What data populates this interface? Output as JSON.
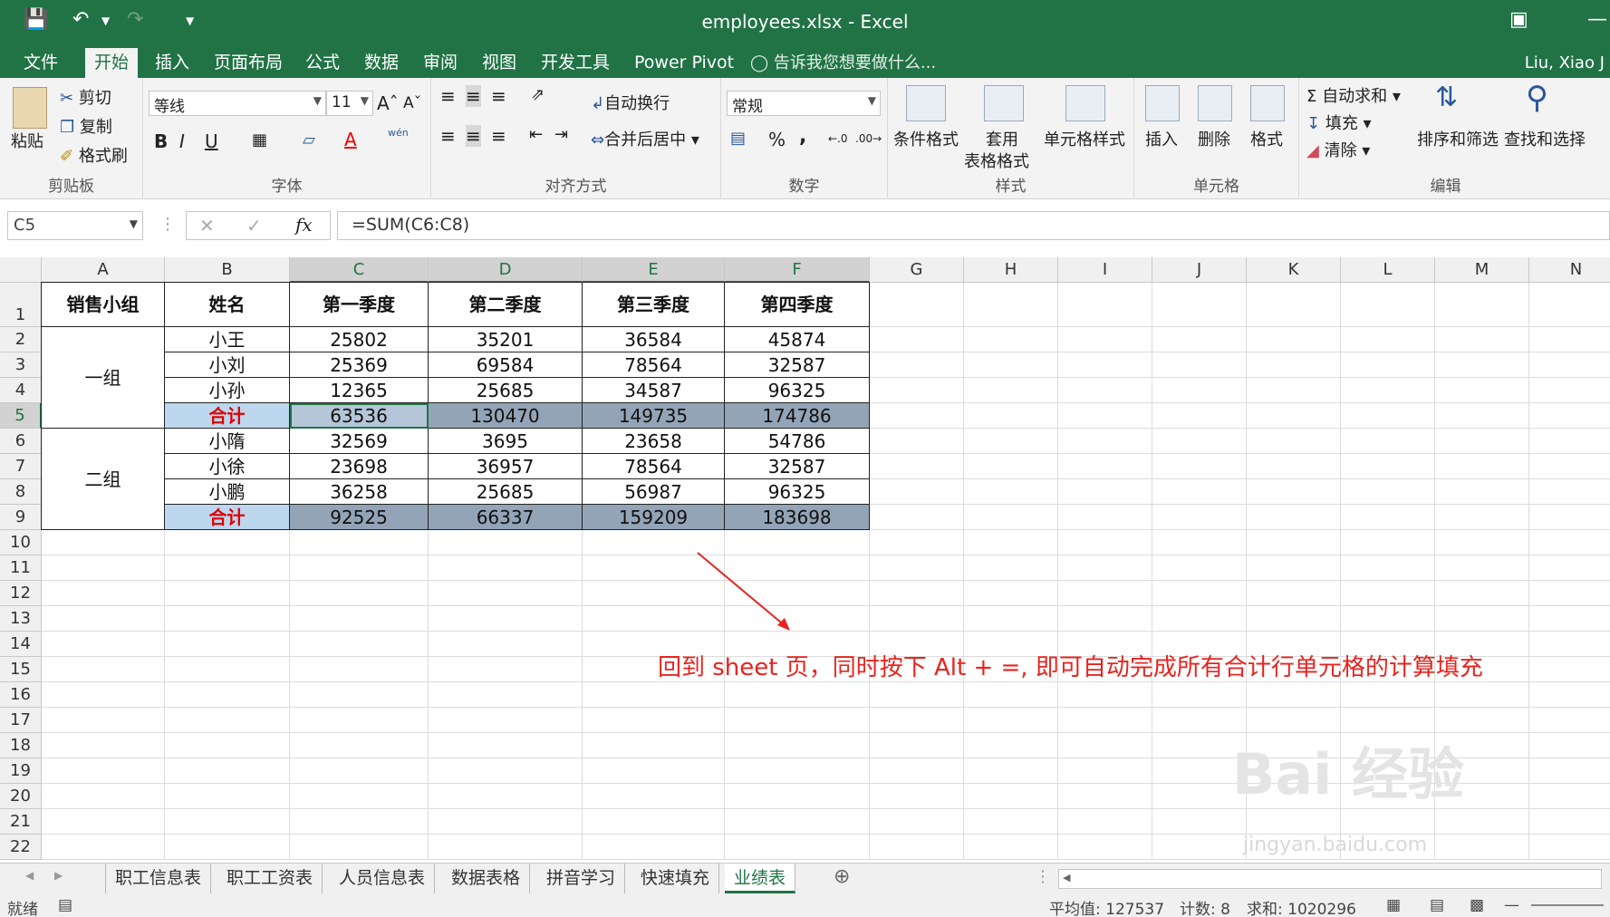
{
  "window": {
    "title": "employees.xlsx - Excel"
  },
  "tabs": [
    "文件",
    "开始",
    "插入",
    "页面布局",
    "公式",
    "数据",
    "审阅",
    "视图",
    "开发工具",
    "Power Pivot"
  ],
  "tell_me": "告诉我您想要做什么...",
  "user": "Liu, Xiao J",
  "ribbon": {
    "clipboard": {
      "paste": "粘贴",
      "cut": "剪切",
      "copy": "复制",
      "format_painter": "格式刷",
      "label": "剪贴板"
    },
    "font": {
      "name": "等线",
      "size": "11",
      "bold": "B",
      "italic": "I",
      "underline": "U",
      "phonetic": "wén",
      "label": "字体"
    },
    "alignment": {
      "wrap": "自动换行",
      "merge": "合并后居中",
      "label": "对齐方式"
    },
    "number": {
      "format": "常规",
      "percent": "%",
      "comma": ",",
      "label": "数字"
    },
    "styles": {
      "conditional": "条件格式",
      "table1": "套用",
      "table2": "表格格式",
      "cell_styles": "单元格样式",
      "label": "样式"
    },
    "cells": {
      "insert": "插入",
      "delete": "删除",
      "format": "格式",
      "label": "单元格"
    },
    "editing": {
      "autosum": "自动求和",
      "fill": "填充",
      "clear": "清除",
      "sort": "排序和筛选",
      "find": "查找和选择",
      "label": "编辑"
    }
  },
  "formula_bar": {
    "name_box": "C5",
    "formula": "=SUM(C6:C8)"
  },
  "columns": [
    "A",
    "B",
    "C",
    "D",
    "E",
    "F",
    "G",
    "H",
    "I",
    "J",
    "K",
    "L",
    "M",
    "N"
  ],
  "rows": [
    "1",
    "2",
    "3",
    "4",
    "5",
    "6",
    "7",
    "8",
    "9",
    "10",
    "11",
    "12",
    "13",
    "14",
    "15",
    "16",
    "17",
    "18",
    "19",
    "20",
    "21",
    "22"
  ],
  "table": {
    "headers": [
      "销售小组",
      "姓名",
      "第一季度",
      "第二季度",
      "第三季度",
      "第四季度"
    ],
    "groups": [
      "一组",
      "二组"
    ],
    "data": [
      [
        "小王",
        "25802",
        "35201",
        "36584",
        "45874"
      ],
      [
        "小刘",
        "25369",
        "69584",
        "78564",
        "32587"
      ],
      [
        "小孙",
        "12365",
        "25685",
        "34587",
        "96325"
      ],
      [
        "合计",
        "63536",
        "130470",
        "149735",
        "174786"
      ],
      [
        "小隋",
        "32569",
        "3695",
        "23658",
        "54786"
      ],
      [
        "小徐",
        "23698",
        "36957",
        "78564",
        "32587"
      ],
      [
        "小鹏",
        "36258",
        "25685",
        "56987",
        "96325"
      ],
      [
        "合计",
        "92525",
        "66337",
        "159209",
        "183698"
      ]
    ]
  },
  "annotation": "回到 sheet 页，同时按下 Alt + =, 即可自动完成所有合计行单元格的计算填充",
  "watermark": {
    "main": "Bai 经验",
    "sub": "jingyan.baidu.com"
  },
  "sheet_tabs": [
    "职工信息表",
    "职工工资表",
    "人员信息表",
    "数据表格",
    "拼音学习",
    "快速填充",
    "业绩表"
  ],
  "status": {
    "ready": "就绪",
    "average": "平均值: 127537",
    "count": "计数: 8",
    "sum": "求和: 1020296"
  },
  "colors": {
    "accent": "#217346",
    "total_fill": "#93a4b7",
    "label_fill": "#bdd7ee",
    "note_red": "#e8231f"
  }
}
